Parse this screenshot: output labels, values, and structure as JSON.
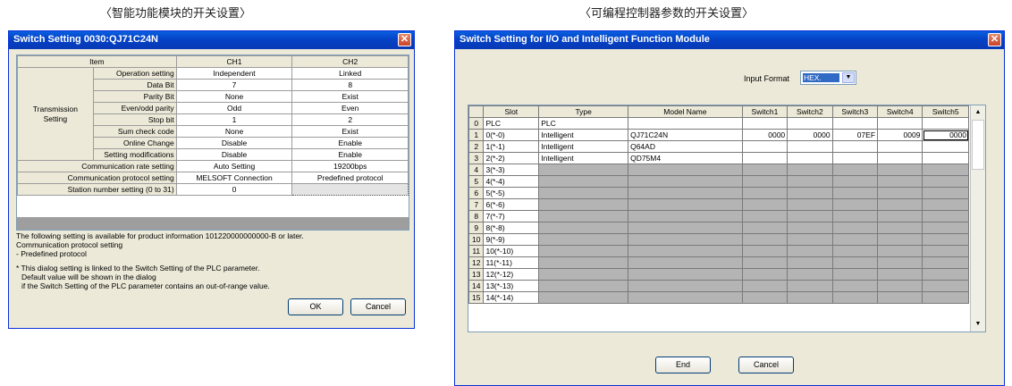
{
  "captions": {
    "left": "〈智能功能模块的开关设置〉",
    "right": "〈可编程控制器参数的开关设置〉"
  },
  "left_dialog": {
    "title": "Switch Setting 0030:QJ71C24N",
    "close": "✕",
    "table": {
      "headers": [
        "Item",
        "CH1",
        "CH2"
      ],
      "group_label_line1": "Transmission",
      "group_label_line2": "Setting",
      "group_rows": [
        {
          "label": "Operation setting",
          "ch1": "Independent",
          "ch2": "Linked"
        },
        {
          "label": "Data Bit",
          "ch1": "7",
          "ch2": "8"
        },
        {
          "label": "Parity Bit",
          "ch1": "None",
          "ch2": "Exist"
        },
        {
          "label": "Even/odd parity",
          "ch1": "Odd",
          "ch2": "Even"
        },
        {
          "label": "Stop bit",
          "ch1": "1",
          "ch2": "2"
        },
        {
          "label": "Sum check code",
          "ch1": "None",
          "ch2": "Exist"
        },
        {
          "label": "Online Change",
          "ch1": "Disable",
          "ch2": "Enable"
        },
        {
          "label": "Setting modifications",
          "ch1": "Disable",
          "ch2": "Enable"
        }
      ],
      "other_rows": [
        {
          "label": "Communication rate setting",
          "ch1": "Auto Setting",
          "ch2": "19200bps"
        },
        {
          "label": "Communication protocol setting",
          "ch1": "MELSOFT Connection",
          "ch2": "Predefined protocol"
        },
        {
          "label": "Station number setting (0 to 31)",
          "ch1": "0",
          "ch2": ""
        }
      ]
    },
    "notes": {
      "line1": "The following setting is available for product information 101220000000000-B or later.",
      "line2": "Communication protocol setting",
      "line3": "- Predefined protocol",
      "line4": "* This dialog setting is linked to the Switch Setting of the PLC parameter.",
      "line5": "Default value will be shown in the dialog",
      "line6": "if the Switch Setting of the PLC parameter contains an out-of-range value."
    },
    "ok": "OK",
    "cancel": "Cancel"
  },
  "right_dialog": {
    "title": "Switch Setting for I/O and Intelligent Function Module",
    "close": "✕",
    "input_format_label": "Input Format",
    "input_format_value": "HEX.",
    "headers": [
      "Slot",
      "Type",
      "Model Name",
      "Switch1",
      "Switch2",
      "Switch3",
      "Switch4",
      "Switch5"
    ],
    "rows": [
      {
        "no": "0",
        "slot": "PLC",
        "type": "PLC",
        "model": "",
        "switches": [
          "",
          "",
          "",
          "",
          ""
        ]
      },
      {
        "no": "1",
        "slot": "0(*-0)",
        "type": "Intelligent",
        "model": "QJ71C24N",
        "switches": [
          "0000",
          "0000",
          "07EF",
          "0009",
          "0000"
        ]
      },
      {
        "no": "2",
        "slot": "1(*-1)",
        "type": "Intelligent",
        "model": "Q64AD",
        "switches": [
          "",
          "",
          "",
          "",
          ""
        ]
      },
      {
        "no": "3",
        "slot": "2(*-2)",
        "type": "Intelligent",
        "model": "QD75M4",
        "switches": [
          "",
          "",
          "",
          "",
          ""
        ]
      },
      {
        "no": "4",
        "slot": "3(*-3)",
        "type": "",
        "model": "",
        "switches": [
          "",
          "",
          "",
          "",
          ""
        ]
      },
      {
        "no": "5",
        "slot": "4(*-4)",
        "type": "",
        "model": "",
        "switches": [
          "",
          "",
          "",
          "",
          ""
        ]
      },
      {
        "no": "6",
        "slot": "5(*-5)",
        "type": "",
        "model": "",
        "switches": [
          "",
          "",
          "",
          "",
          ""
        ]
      },
      {
        "no": "7",
        "slot": "6(*-6)",
        "type": "",
        "model": "",
        "switches": [
          "",
          "",
          "",
          "",
          ""
        ]
      },
      {
        "no": "8",
        "slot": "7(*-7)",
        "type": "",
        "model": "",
        "switches": [
          "",
          "",
          "",
          "",
          ""
        ]
      },
      {
        "no": "9",
        "slot": "8(*-8)",
        "type": "",
        "model": "",
        "switches": [
          "",
          "",
          "",
          "",
          ""
        ]
      },
      {
        "no": "10",
        "slot": "9(*-9)",
        "type": "",
        "model": "",
        "switches": [
          "",
          "",
          "",
          "",
          ""
        ]
      },
      {
        "no": "11",
        "slot": "10(*-10)",
        "type": "",
        "model": "",
        "switches": [
          "",
          "",
          "",
          "",
          ""
        ]
      },
      {
        "no": "12",
        "slot": "11(*-11)",
        "type": "",
        "model": "",
        "switches": [
          "",
          "",
          "",
          "",
          ""
        ]
      },
      {
        "no": "13",
        "slot": "12(*-12)",
        "type": "",
        "model": "",
        "switches": [
          "",
          "",
          "",
          "",
          ""
        ]
      },
      {
        "no": "14",
        "slot": "13(*-13)",
        "type": "",
        "model": "",
        "switches": [
          "",
          "",
          "",
          "",
          ""
        ]
      },
      {
        "no": "15",
        "slot": "14(*-14)",
        "type": "",
        "model": "",
        "switches": [
          "",
          "",
          "",
          "",
          ""
        ]
      }
    ],
    "end": "End",
    "cancel": "Cancel"
  },
  "icons": {
    "close": "close-icon",
    "dropdown": "chevron-down-icon",
    "scroll_up": "scroll-up-arrow-icon",
    "scroll_down": "scroll-down-arrow-icon"
  },
  "colors": {
    "title_bar": "#0A5FE0",
    "dialog_bg": "#ECE9D8",
    "empty_cell": "#B4B4B4",
    "selection": "#316AC5"
  }
}
